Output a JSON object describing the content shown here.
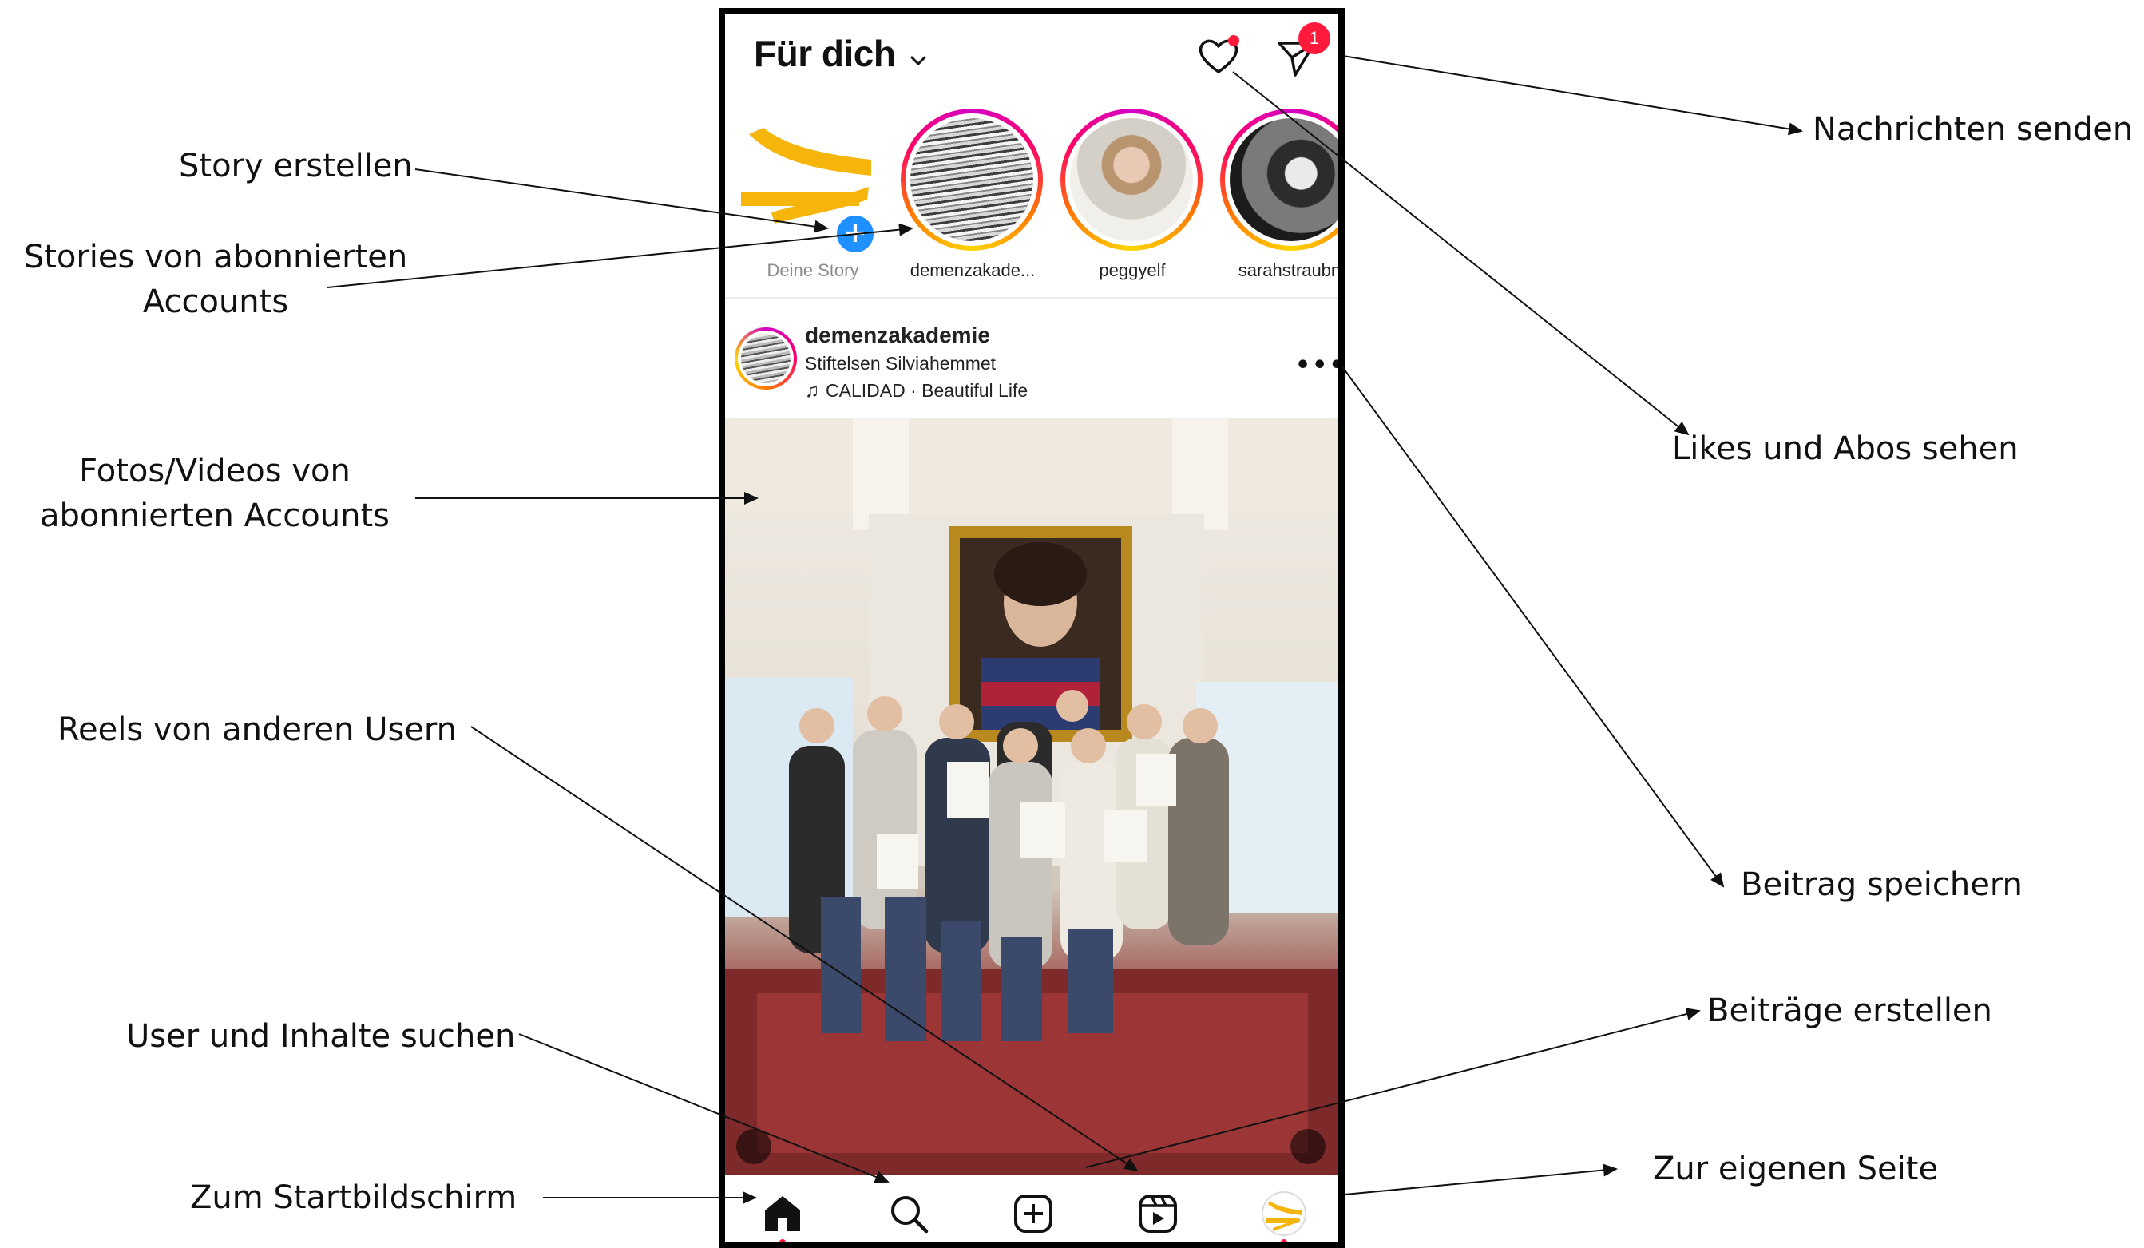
{
  "phone": {
    "feed_title": "Für dich",
    "notification_count": "1",
    "stories": [
      {
        "label": "Deine Story",
        "own": true
      },
      {
        "label": "demenzakade..."
      },
      {
        "label": "peggyelf"
      },
      {
        "label": "sarahstraubm"
      }
    ],
    "post": {
      "username": "demenzakademie",
      "location": "Stiftelsen Silviahemmet",
      "music": "CALIDAD · Beautiful Life"
    },
    "nav": [
      {
        "icon": "home-icon",
        "active": true
      },
      {
        "icon": "search-icon"
      },
      {
        "icon": "create-post-icon"
      },
      {
        "icon": "reels-icon"
      },
      {
        "icon": "profile-avatar-icon"
      }
    ]
  },
  "annotations": {
    "story_erstellen": "Story erstellen",
    "stories_von": [
      "Stories von abonnierten",
      "Accounts"
    ],
    "fotos_videos": [
      "Fotos/Videos von",
      "abonnierten Accounts"
    ],
    "reels": "Reels von anderen Usern",
    "suchen": "User und Inhalte suchen",
    "startbildschirm": "Zum Startbildschirm",
    "nachrichten": "Nachrichten senden",
    "likes": "Likes und Abos sehen",
    "speichern": "Beitrag speichern",
    "erstellen": "Beiträge erstellen",
    "eigene_seite": "Zur eigenen Seite"
  },
  "colors": {
    "brand_yellow": "#f5b50a",
    "badge_red": "#ff1a3c",
    "add_story_blue": "#1e90ff"
  }
}
